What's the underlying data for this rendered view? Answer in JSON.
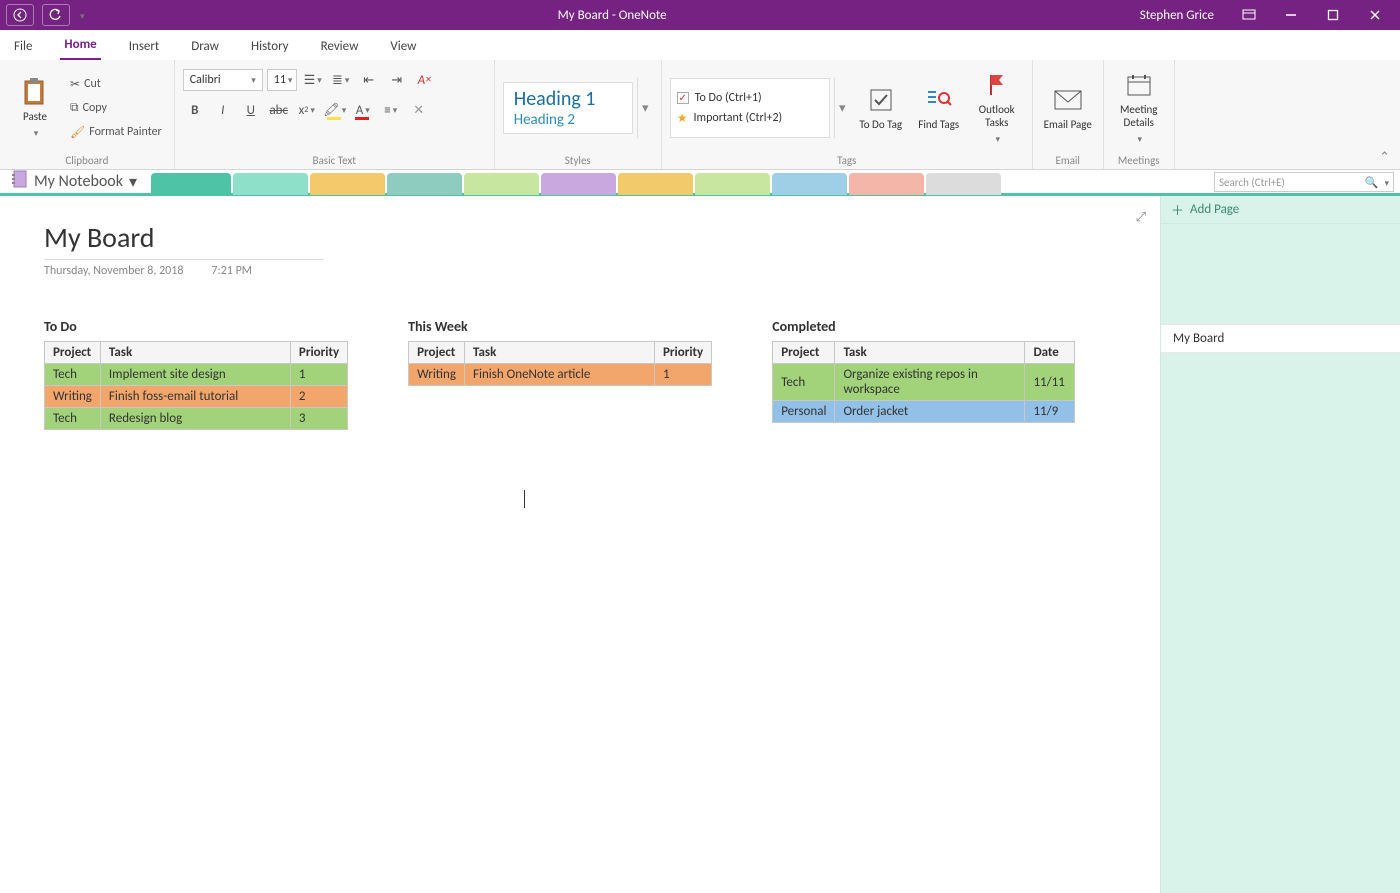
{
  "app": {
    "title": "My Board  -  OneNote",
    "user": "Stephen Grice"
  },
  "ribbonTabs": [
    "File",
    "Home",
    "Insert",
    "Draw",
    "History",
    "Review",
    "View"
  ],
  "activeTab": "Home",
  "clipboard": {
    "paste": "Paste",
    "cut": "Cut",
    "copy": "Copy",
    "formatPainter": "Format Painter",
    "label": "Clipboard"
  },
  "basicText": {
    "label": "Basic Text",
    "font": "Calibri",
    "size": "11"
  },
  "styles": {
    "label": "Styles",
    "h1": "Heading 1",
    "h2": "Heading 2"
  },
  "tags": {
    "label": "Tags",
    "todo": "To Do (Ctrl+1)",
    "important": "Important (Ctrl+2)",
    "todoTag": "To Do Tag",
    "findTags": "Find Tags",
    "outlook": "Outlook Tasks"
  },
  "email": {
    "label": "Email",
    "btn": "Email Page"
  },
  "meetings": {
    "label": "Meetings",
    "btn": "Meeting Details"
  },
  "notebook": {
    "name": "My Notebook"
  },
  "search": {
    "placeholder": "Search (Ctrl+E)"
  },
  "page": {
    "title": "My Board",
    "date": "Thursday, November 8, 2018",
    "time": "7:21 PM"
  },
  "sectionColors": [
    "#4ec3a5",
    "#8fe0c9",
    "#f4c96b",
    "#8fccc0",
    "#c7e6a0",
    "#c9a8e0",
    "#f2c96b",
    "#c9e6a0",
    "#9fcfe6",
    "#f4b6a8",
    "#dcdcdc"
  ],
  "boards": [
    {
      "title": "To Do",
      "cols": [
        "Project",
        "Task",
        "Priority"
      ],
      "rows": [
        {
          "c": "green",
          "cells": [
            "Tech",
            "Implement site design",
            "1"
          ]
        },
        {
          "c": "orange",
          "cells": [
            "Writing",
            "Finish foss-email tutorial",
            "2"
          ]
        },
        {
          "c": "green",
          "cells": [
            "Tech",
            "Redesign blog",
            "3"
          ]
        }
      ],
      "widths": [
        55,
        190,
        55
      ]
    },
    {
      "title": "This Week",
      "cols": [
        "Project",
        "Task",
        "Priority"
      ],
      "rows": [
        {
          "c": "orange",
          "cells": [
            "Writing",
            "Finish OneNote article",
            "1"
          ]
        }
      ],
      "widths": [
        55,
        190,
        55
      ]
    },
    {
      "title": "Completed",
      "cols": [
        "Project",
        "Task",
        "Date"
      ],
      "rows": [
        {
          "c": "green",
          "cells": [
            "Tech",
            "Organize existing repos in workspace",
            "11/11"
          ]
        },
        {
          "c": "blue",
          "cells": [
            "Personal",
            "Order jacket",
            "11/9"
          ]
        }
      ],
      "widths": [
        60,
        190,
        50
      ]
    }
  ],
  "pagePane": {
    "addPage": "Add Page",
    "pages": [
      "My Board"
    ]
  }
}
